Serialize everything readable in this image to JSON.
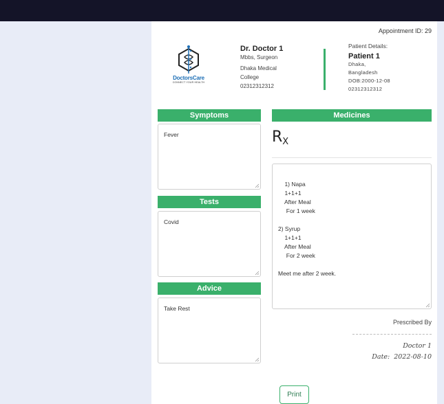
{
  "appointment": {
    "label": "Appointment ID:",
    "id": "29"
  },
  "logo": {
    "brand": "DoctorsCare",
    "tagline": "CONNECT YOUR HEALTH"
  },
  "doctor": {
    "name": "Dr. Doctor 1",
    "degree": "Mbbs, Surgeon",
    "hospital_line1": "Dhaka Medical",
    "hospital_line2": "College",
    "phone": "02312312312"
  },
  "patient": {
    "label": "Patient Details:",
    "name": "Patient 1",
    "address_line1": "Dhaka,",
    "address_line2": "Bangladesh",
    "dob": "DOB:2000-12-08",
    "phone": "02312312312"
  },
  "sections": {
    "symptoms": {
      "title": "Symptoms",
      "value": "Fever"
    },
    "tests": {
      "title": "Tests",
      "value": "Covid"
    },
    "advice": {
      "title": "Advice",
      "value": "Take Rest"
    },
    "medicines": {
      "title": "Medicines",
      "rx_main": "R",
      "rx_sub": "X",
      "value": "1) Napa\n    1+1+1\n    After Meal\n     For 1 week\n\n2) Syrup\n    1+1+1\n    After Meal\n     For 2 week\n\nMeet me after 2 week."
    }
  },
  "signature": {
    "prescribed_by": "Prescribed By",
    "name": "Doctor 1",
    "date_label": "Date:",
    "date": "2022-08-10"
  },
  "actions": {
    "print": "Print"
  },
  "colors": {
    "accent": "#3ab06b",
    "topbar": "#141428",
    "background": "#e8ecf7",
    "logo_blue": "#1e6fb6"
  }
}
